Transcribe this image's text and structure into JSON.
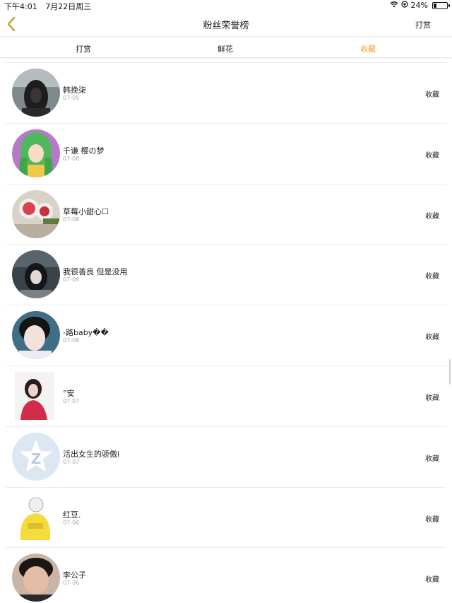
{
  "status_bar": {
    "time": "下午4:01",
    "date": "7月22日周三",
    "battery_text": "24%",
    "battery_level": 0.24
  },
  "nav": {
    "title": "粉丝荣誉榜",
    "right_label": "打赏",
    "accent_color": "#c7a33a"
  },
  "tabs": [
    {
      "label": "打赏",
      "active": false
    },
    {
      "label": "鲜花",
      "active": false
    },
    {
      "label": "收藏",
      "active": true
    }
  ],
  "active_tab_color": "#f2a526",
  "fans": [
    {
      "name": "韩挽柒",
      "date": "07-09",
      "action": "收藏",
      "avatar": "dark-hair-girl-photo"
    },
    {
      "name": "千谦 樱の梦",
      "date": "07-08",
      "action": "收藏",
      "avatar": "green-hair-anime-girl"
    },
    {
      "name": "草莓小甜心☐",
      "date": "07-08",
      "action": "收藏",
      "avatar": "strawberry-dessert-photo"
    },
    {
      "name": "我很善良 但是没用",
      "date": "07-08",
      "action": "收藏",
      "avatar": "girl-dark-photo"
    },
    {
      "name": "-路baby��",
      "date": "07-08",
      "action": "收藏",
      "avatar": "boy-portrait"
    },
    {
      "name": "°安",
      "date": "07-07",
      "action": "收藏",
      "avatar": "girl-red-shirt"
    },
    {
      "name": "活出女生的骄傲i",
      "date": "07-07",
      "action": "收藏",
      "avatar": "default-z-logo"
    },
    {
      "name": "红豆.",
      "date": "07-06",
      "action": "收藏",
      "avatar": "yellow-sweater-cartoon"
    },
    {
      "name": "李公子",
      "date": "07-06",
      "action": "收藏",
      "avatar": "young-man-portrait"
    }
  ]
}
